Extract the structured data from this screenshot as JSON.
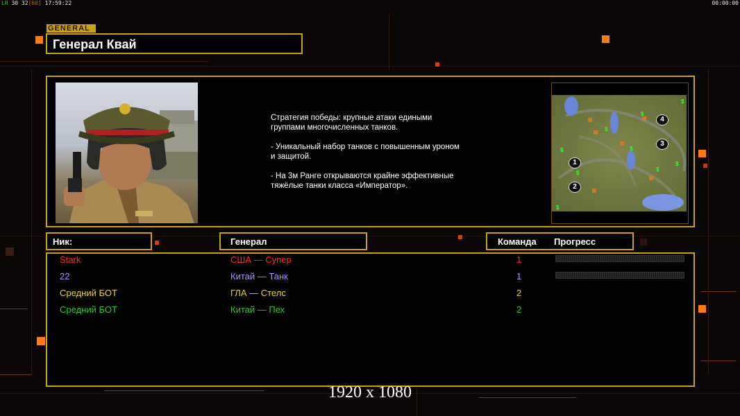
{
  "topbar": {
    "fps_label": "LR",
    "stats": "30 32",
    "bracket": "[60]",
    "clock": "17:59:22",
    "timer": "00:00:00"
  },
  "general_tag": "GENERAL",
  "general_name": "Генерал Квай",
  "description": "Стратегия победы: крупные атаки едиными\n группами многочисленных танков.\n\n- Уникальный набор танков с повышенным уроном\n и защитой.\n\n- На 3м Ранге открываются крайне эффективные\n тяжёлые танки класса «Император».",
  "headers": {
    "nick": "Ник:",
    "general": "Генерал",
    "team": "Команда",
    "progress": "Прогресс"
  },
  "players": [
    {
      "nick": "Stark",
      "general": "США — Супер",
      "team": "1",
      "color": "#ff2a2a",
      "show_progress": true
    },
    {
      "nick": "22",
      "general": "Китай — Танк",
      "team": "1",
      "color": "#9a9aff",
      "show_progress": true
    },
    {
      "nick": "Средний БОТ",
      "general": "ГЛА — Стелс",
      "team": "2",
      "color": "#e5d23a",
      "show_progress": false
    },
    {
      "nick": "Средний БОТ",
      "general": "Китай — Пех",
      "team": "2",
      "color": "#2ec82e",
      "show_progress": false
    }
  ],
  "map": {
    "start_positions": [
      "1",
      "2",
      "3",
      "4"
    ],
    "cash_marker": "$"
  },
  "resolution": "1920 x 1080",
  "colors": {
    "accent": "#c9a21a",
    "bg": "#0b0707",
    "deco_orange": "#ff7a10",
    "deco_red": "#e23a10"
  }
}
